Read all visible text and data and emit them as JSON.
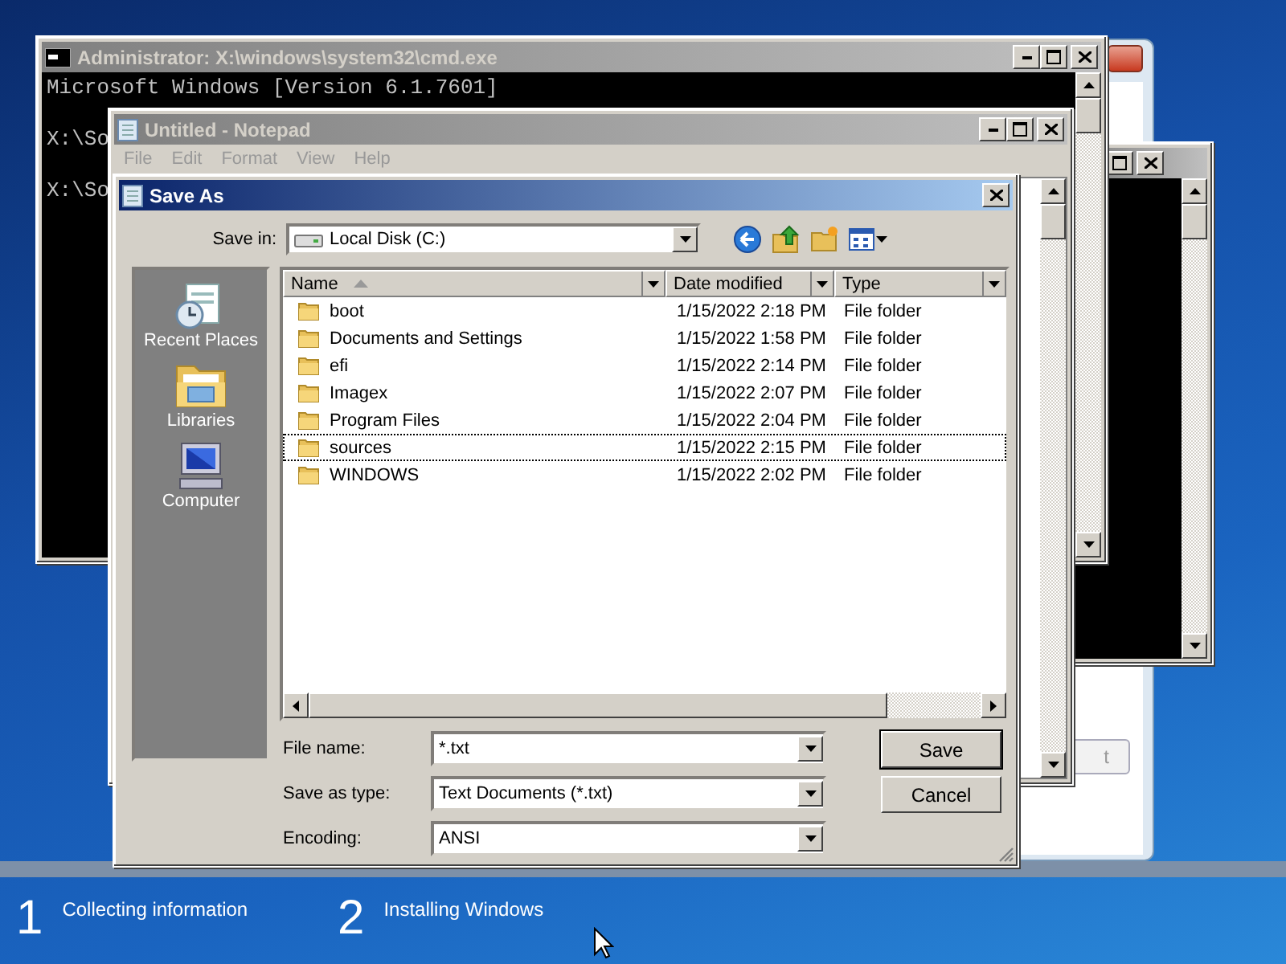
{
  "desktop": {
    "steps": [
      {
        "number": "1",
        "label": "Collecting information"
      },
      {
        "number": "2",
        "label": "Installing Windows"
      }
    ]
  },
  "setup_window": {
    "button": "t"
  },
  "console_window": {
    "title": "Administrator: X:\\windows\\system32\\cmd.exe",
    "lines": [
      "Microsoft Windows [Version 6.1.7601]",
      "X:\\So",
      "X:\\So"
    ]
  },
  "notepad": {
    "title": "Untitled - Notepad",
    "menu": [
      "File",
      "Edit",
      "Format",
      "View",
      "Help"
    ]
  },
  "save_dialog": {
    "title": "Save As",
    "save_in_label": "Save in:",
    "save_in": "Local Disk (C:)",
    "places": [
      {
        "label": "Recent Places",
        "kind": "recent"
      },
      {
        "label": "Libraries",
        "kind": "libraries"
      },
      {
        "label": "Computer",
        "kind": "computer"
      }
    ],
    "columns": [
      {
        "label": "Name",
        "sorted": true
      },
      {
        "label": "Date modified",
        "sorted": false
      },
      {
        "label": "Type",
        "sorted": false
      }
    ],
    "rows": [
      {
        "name": "boot",
        "date": "1/15/2022 2:18 PM",
        "type": "File folder",
        "focused": false
      },
      {
        "name": "Documents and Settings",
        "date": "1/15/2022 1:58 PM",
        "type": "File folder",
        "focused": false
      },
      {
        "name": "efi",
        "date": "1/15/2022 2:14 PM",
        "type": "File folder",
        "focused": false
      },
      {
        "name": "Imagex",
        "date": "1/15/2022 2:07 PM",
        "type": "File folder",
        "focused": false
      },
      {
        "name": "Program Files",
        "date": "1/15/2022 2:04 PM",
        "type": "File folder",
        "focused": false
      },
      {
        "name": "sources",
        "date": "1/15/2022 2:15 PM",
        "type": "File folder",
        "focused": true
      },
      {
        "name": "WINDOWS",
        "date": "1/15/2022 2:02 PM",
        "type": "File folder",
        "focused": false
      }
    ],
    "fields": [
      {
        "label": "File name:",
        "value": "*.txt"
      },
      {
        "label": "Save as type:",
        "value": "Text Documents (*.txt)"
      },
      {
        "label": "Encoding:",
        "value": "ANSI"
      }
    ],
    "buttons": [
      {
        "label": "Save",
        "default": true
      },
      {
        "label": "Cancel",
        "default": false
      }
    ]
  }
}
